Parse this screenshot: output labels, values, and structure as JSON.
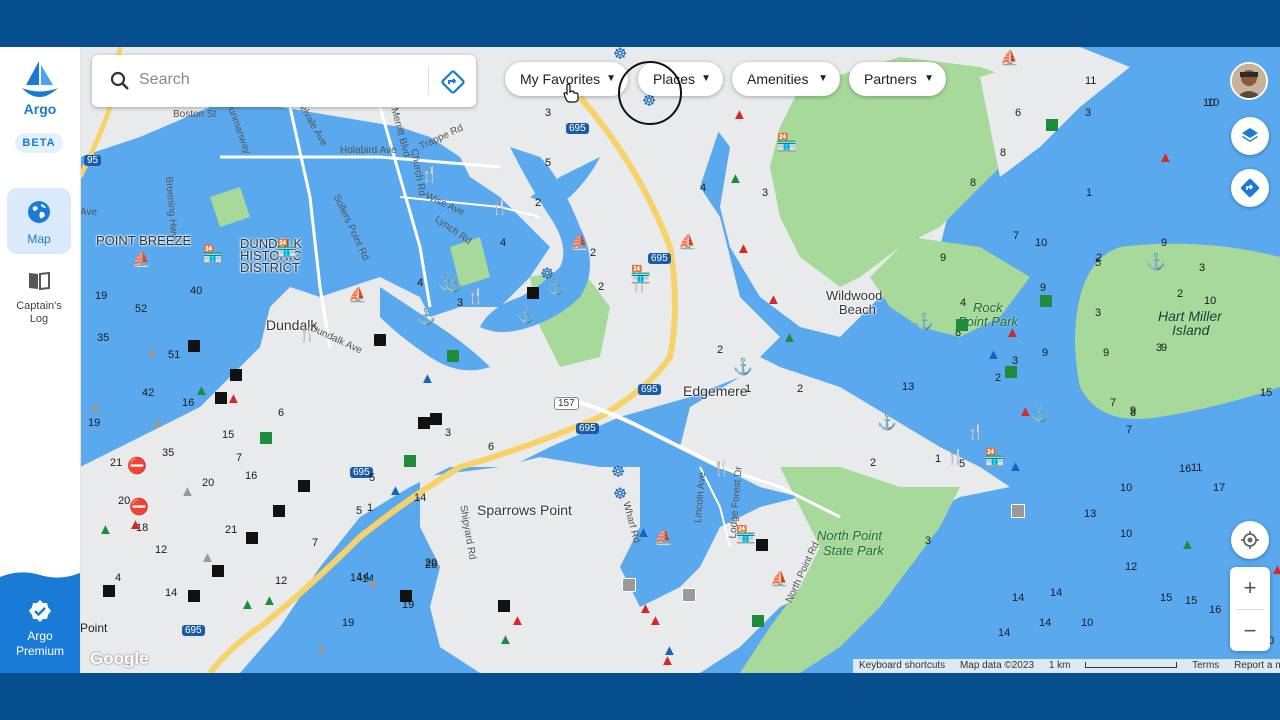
{
  "app": {
    "name": "Argo",
    "badge": "BETA"
  },
  "sidebar": {
    "map_label": "Map",
    "log_label": "Captain's Log",
    "premium_label": "Argo Premium"
  },
  "search": {
    "placeholder": "Search"
  },
  "filters": [
    {
      "label": "My Favorites"
    },
    {
      "label": "Places"
    },
    {
      "label": "Amenities"
    },
    {
      "label": "Partners"
    }
  ],
  "map": {
    "places": {
      "point_breeze": "POINT BREEZE",
      "dundalk_historic_1": "DUNDALK",
      "dundalk_historic_2": "HISTORIC",
      "dundalk_historic_3": "DISTRICT",
      "dundalk": "Dundalk",
      "edgemere": "Edgemere",
      "sparrows_point": "Sparrows Point",
      "wildwood_1": "Wildwood",
      "wildwood_2": "Beach",
      "rocky_point_1": "Rock",
      "rocky_point_2": "Point Park",
      "hart_miller_1": "Hart Miller",
      "hart_miller_2": "Island",
      "north_point_1": "North Point",
      "north_point_2": "State Park"
    },
    "roads": {
      "boston_st": "Boston St",
      "dunmanway": "Dunmanway",
      "delvale": "Delvale Ave",
      "merritt_blvd": "Merritt Blvd",
      "holabird": "Holabird Ave",
      "trappe": "Trappe Rd",
      "church": "Church Rd",
      "wise": "Wise Ave",
      "lynch": "Lynch Rd",
      "sollers": "Sollers Point Rd",
      "dundalk_ave": "Dundalk Ave",
      "broening": "Broening Hwy",
      "wharf": "Wharf Rd",
      "lincoln": "Lincoln Ave",
      "lodge_forest": "Lodge Forest Dr",
      "north_point_rd": "North Point Rd",
      "shipyard": "Shipyard Rd",
      "i695": "695",
      "r157": "157",
      "i95": "95",
      "ave_w": "Ave",
      "point_sw": "Point"
    },
    "depths": [
      "3",
      "5",
      "2",
      "4",
      "3",
      "8",
      "7",
      "9",
      "10",
      "11",
      "3",
      "1",
      "2",
      "6",
      "8",
      "9",
      "10",
      "4",
      "5",
      "3",
      "9",
      "10",
      "7",
      "8",
      "19",
      "52",
      "35",
      "40",
      "51",
      "42",
      "16",
      "19",
      "15",
      "21",
      "35",
      "16",
      "20",
      "20",
      "18",
      "12",
      "21",
      "4",
      "14",
      "14",
      "12",
      "20",
      "5",
      "7",
      "1",
      "3",
      "14",
      "28",
      "19",
      "19",
      "6",
      "7",
      "5",
      "6",
      "4",
      "2",
      "2",
      "4",
      "3",
      "14",
      "14",
      "16",
      "15",
      "11",
      "10",
      "13",
      "17",
      "12",
      "14",
      "14",
      "10",
      "10",
      "5",
      "9",
      "9",
      "3",
      "3",
      "2",
      "10",
      "15",
      "16",
      "15",
      "10",
      "14",
      "14",
      "3",
      "2",
      "1",
      "2",
      "3",
      "2",
      "1",
      "2",
      "13",
      "8",
      "9",
      "9",
      "7"
    ]
  },
  "attribution": {
    "shortcuts": "Keyboard shortcuts",
    "mapdata": "Map data ©2023",
    "scale": "1 km",
    "terms": "Terms",
    "report": "Report a map error",
    "google": "Google"
  },
  "colors": {
    "water": "#5aa9ee",
    "land": "#e9eaec",
    "park": "#a7d99a",
    "brand": "#1a7bd6",
    "frame": "#064e8e"
  }
}
